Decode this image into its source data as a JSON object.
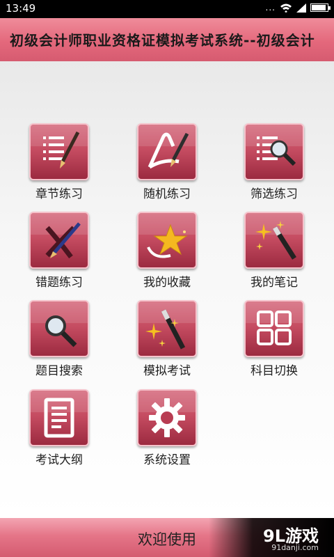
{
  "status_bar": {
    "time": "13:49",
    "dots": "..."
  },
  "header": {
    "title": "初级会计师职业资格证模拟考试系统--初级会计"
  },
  "menu": [
    {
      "label": "章节练习",
      "icon": "chapter-practice-icon"
    },
    {
      "label": "随机练习",
      "icon": "random-practice-icon"
    },
    {
      "label": "筛选练习",
      "icon": "filter-practice-icon"
    },
    {
      "label": "错题练习",
      "icon": "wrong-questions-icon"
    },
    {
      "label": "我的收藏",
      "icon": "favorites-star-icon"
    },
    {
      "label": "我的笔记",
      "icon": "notes-wand-icon"
    },
    {
      "label": "题目搜索",
      "icon": "search-magnifier-icon"
    },
    {
      "label": "模拟考试",
      "icon": "mock-exam-wand-icon"
    },
    {
      "label": "科目切换",
      "icon": "subject-switch-grid-icon"
    },
    {
      "label": "考试大纲",
      "icon": "exam-outline-document-icon"
    },
    {
      "label": "系统设置",
      "icon": "settings-gear-icon"
    }
  ],
  "footer": {
    "label": "欢迎使用"
  },
  "watermark": {
    "logo": "9L游戏",
    "site": "91danji.com"
  },
  "colors": {
    "accent": "#c64d62",
    "header": "#e4687c"
  }
}
